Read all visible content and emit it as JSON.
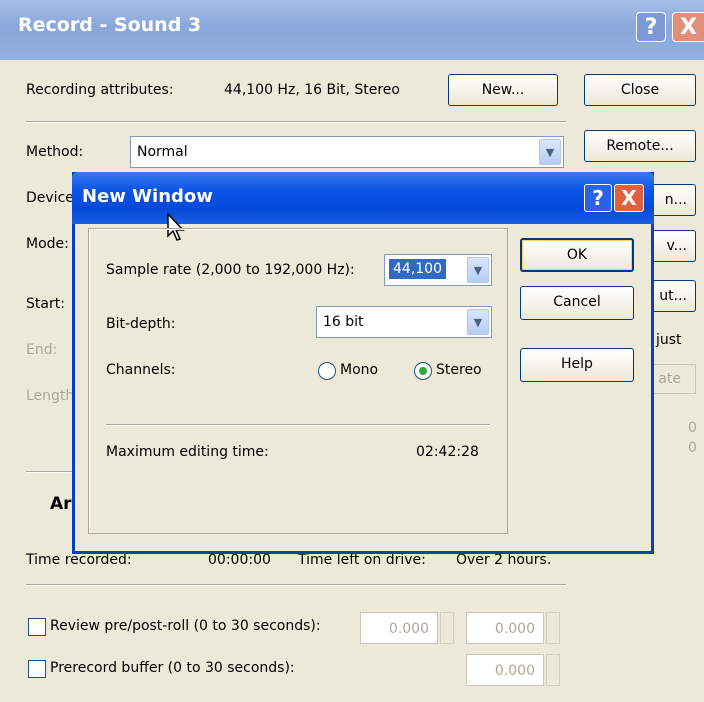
{
  "outer": {
    "title": "Record - Sound 3",
    "help_icon": "?",
    "close_icon": "X",
    "recording_attributes_label": "Recording attributes:",
    "recording_attributes_value": "44,100 Hz, 16 Bit, Stereo",
    "new_button": "New...",
    "close_button": "Close",
    "method_label": "Method:",
    "method_value": "Normal",
    "remote_button": "Remote...",
    "device_label": "Device",
    "mode_label": "Mode:",
    "start_label": "Start:",
    "end_label": "End:",
    "length_label": "Length",
    "partial_btn1": "n...",
    "partial_btn2": "v...",
    "partial_btn3": "ut...",
    "adjust_label": "just",
    "update_label": "ate",
    "zero1": "0",
    "zero2": "0",
    "arm_label": "Ar",
    "time_recorded_label": "Time recorded:",
    "time_recorded_value": "00:00:00",
    "time_left_label": "Time left on drive:",
    "time_left_value": "Over 2 hours.",
    "review_label": "Review pre/post-roll (0 to 30 seconds):",
    "review_pre_value": "0.000",
    "review_post_value": "0.000",
    "prerecord_label": "Prerecord buffer (0 to 30 seconds):",
    "prerecord_value": "0.000"
  },
  "modal": {
    "title": "New Window",
    "help_icon": "?",
    "close_icon": "X",
    "sample_rate_label": "Sample rate (2,000 to 192,000 Hz):",
    "sample_rate_value": "44,100",
    "bit_depth_label": "Bit-depth:",
    "bit_depth_value": "16 bit",
    "channels_label": "Channels:",
    "mono_label": "Mono",
    "stereo_label": "Stereo",
    "selected_channel": "Stereo",
    "max_edit_label": "Maximum editing time:",
    "max_edit_value": "02:42:28",
    "ok_button": "OK",
    "cancel_button": "Cancel",
    "help_button": "Help"
  }
}
